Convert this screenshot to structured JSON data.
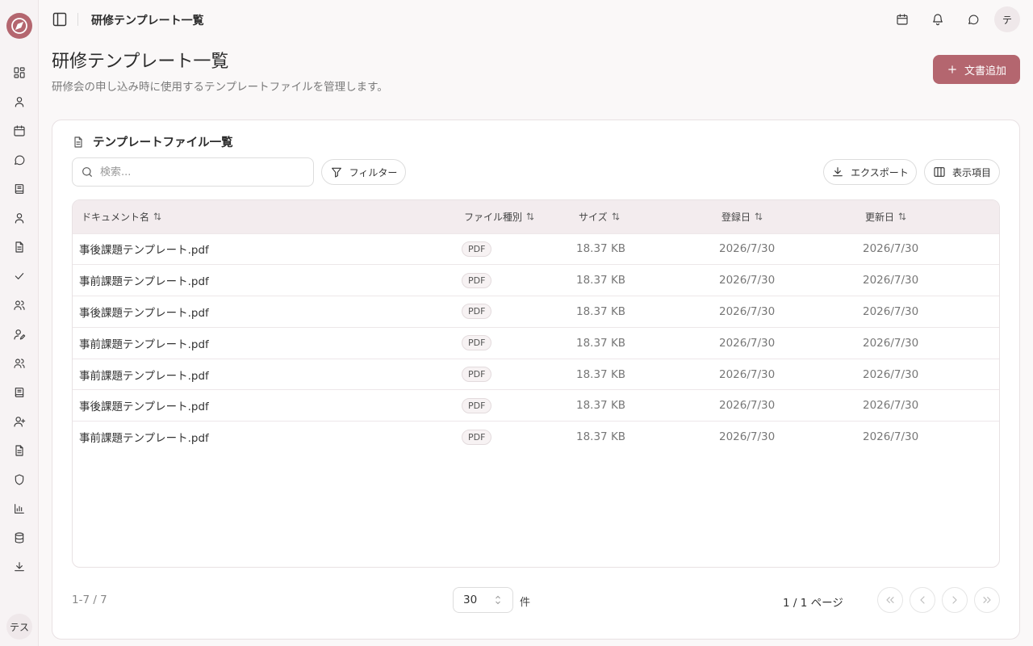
{
  "sidebar": {
    "items": [
      {
        "icon": "dashboard-icon"
      },
      {
        "icon": "user-icon"
      },
      {
        "icon": "calendar-icon"
      },
      {
        "icon": "chat-icon"
      },
      {
        "icon": "book-icon"
      },
      {
        "icon": "person-icon"
      },
      {
        "icon": "file-text-icon"
      },
      {
        "icon": "check-icon"
      },
      {
        "icon": "users-icon"
      },
      {
        "icon": "user-edit-icon"
      },
      {
        "icon": "group-icon"
      },
      {
        "icon": "notebook-icon"
      },
      {
        "icon": "user-plus-icon"
      },
      {
        "icon": "document-icon"
      },
      {
        "icon": "shield-icon"
      },
      {
        "icon": "bar-chart-icon"
      },
      {
        "icon": "database-icon"
      },
      {
        "icon": "download-icon"
      }
    ],
    "avatar_label": "テス"
  },
  "header": {
    "breadcrumb": "研修テンプレート一覧",
    "avatar_label": "テ"
  },
  "page": {
    "title": "研修テンプレート一覧",
    "description": "研修会の申し込み時に使用するテンプレートファイルを管理します。",
    "add_button": "文書追加"
  },
  "card": {
    "title": "テンプレートファイル一覧",
    "search_placeholder": "検索...",
    "filter_label": "フィルター",
    "export_label": "エクスポート",
    "columns_label": "表示項目"
  },
  "table": {
    "headers": [
      "ドキュメント名",
      "ファイル種別",
      "サイズ",
      "登録日",
      "更新日"
    ],
    "rows": [
      {
        "name": "事後課題テンプレート.pdf",
        "type": "PDF",
        "size": "18.37 KB",
        "created": "2026/7/30",
        "updated": "2026/7/30"
      },
      {
        "name": "事前課題テンプレート.pdf",
        "type": "PDF",
        "size": "18.37 KB",
        "created": "2026/7/30",
        "updated": "2026/7/30"
      },
      {
        "name": "事後課題テンプレート.pdf",
        "type": "PDF",
        "size": "18.37 KB",
        "created": "2026/7/30",
        "updated": "2026/7/30"
      },
      {
        "name": "事前課題テンプレート.pdf",
        "type": "PDF",
        "size": "18.37 KB",
        "created": "2026/7/30",
        "updated": "2026/7/30"
      },
      {
        "name": "事前課題テンプレート.pdf",
        "type": "PDF",
        "size": "18.37 KB",
        "created": "2026/7/30",
        "updated": "2026/7/30"
      },
      {
        "name": "事後課題テンプレート.pdf",
        "type": "PDF",
        "size": "18.37 KB",
        "created": "2026/7/30",
        "updated": "2026/7/30"
      },
      {
        "name": "事前課題テンプレート.pdf",
        "type": "PDF",
        "size": "18.37 KB",
        "created": "2026/7/30",
        "updated": "2026/7/30"
      }
    ]
  },
  "pagination": {
    "count_text": "1-7 / 7",
    "page_size": "30",
    "unit": "件",
    "page_info": "1 / 1 ページ"
  },
  "colors": {
    "accent": "#b4666f",
    "header_row": "#f3ecee"
  }
}
